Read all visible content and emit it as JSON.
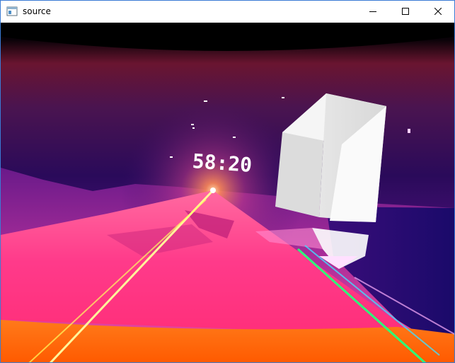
{
  "window": {
    "title": "source",
    "minimize_icon": "minimize-icon",
    "maximize_icon": "maximize-icon",
    "close_icon": "close-icon",
    "app_icon": "app-window-icon"
  },
  "game": {
    "timer": "58:20"
  },
  "colors": {
    "sky_top": "#2a0b4d",
    "horizon_glow": "#ff8a3c",
    "floor_pink": "#ff3d8a",
    "floor_orange": "#ff6a00",
    "cube": "#f2f2f2",
    "laser": "#fff59a"
  }
}
